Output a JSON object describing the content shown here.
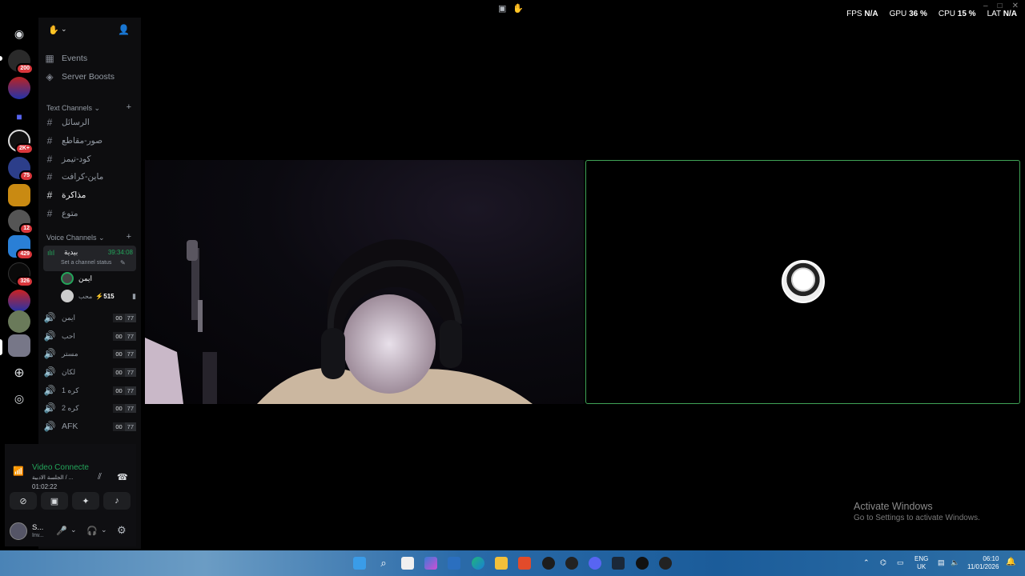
{
  "topbar": {
    "overlay": {
      "fps_label": "FPS",
      "fps_value": "N/A",
      "gpu_label": "GPU",
      "gpu_value": "36 %",
      "cpu_label": "CPU",
      "cpu_value": "15 %",
      "lat_label": "LAT",
      "lat_value": "N/A"
    }
  },
  "rail": {
    "badges": [
      "200",
      "2K+",
      "75",
      "12",
      "429",
      "326"
    ]
  },
  "sidebar": {
    "events_label": "Events",
    "boosts_label": "Server Boosts",
    "text_category": "Text Channels",
    "text_channels": [
      "الرسائل",
      "صور-مقاطع",
      "كود-تيمز",
      "ماين-كرافت",
      "مذاكرة",
      "متوع"
    ],
    "voice_category": "Voice Channels",
    "active_voice": {
      "name": "بيدية",
      "timer": "39:34:08",
      "status_hint": "Set a channel status",
      "members": [
        {
          "name": "ايمن"
        },
        {
          "name": "محب",
          "extra": "515"
        }
      ]
    },
    "voice_channels": [
      {
        "name": "ايمن",
        "a": "00",
        "b": "77"
      },
      {
        "name": "احب",
        "a": "00",
        "b": "77"
      },
      {
        "name": "مستر",
        "a": "00",
        "b": "77"
      },
      {
        "name": "لكان",
        "a": "00",
        "b": "77"
      },
      {
        "name": "1 كره",
        "a": "00",
        "b": "77"
      },
      {
        "name": "2 كره",
        "a": "00",
        "b": "77"
      },
      {
        "name": "AFK",
        "a": "00",
        "b": "77"
      }
    ]
  },
  "voice_panel": {
    "status": "Video Connecte",
    "channel": "الجلسة الادبية / ...",
    "elapsed": "01:02:22"
  },
  "user_panel": {
    "name": "S...",
    "sub": "Inv..."
  },
  "watermark": {
    "title": "Activate Windows",
    "subtitle": "Go to Settings to activate Windows."
  },
  "taskbar": {
    "lang_top": "ENG",
    "lang_bottom": "UK",
    "time": "06:10",
    "date": "11/01/2026"
  }
}
